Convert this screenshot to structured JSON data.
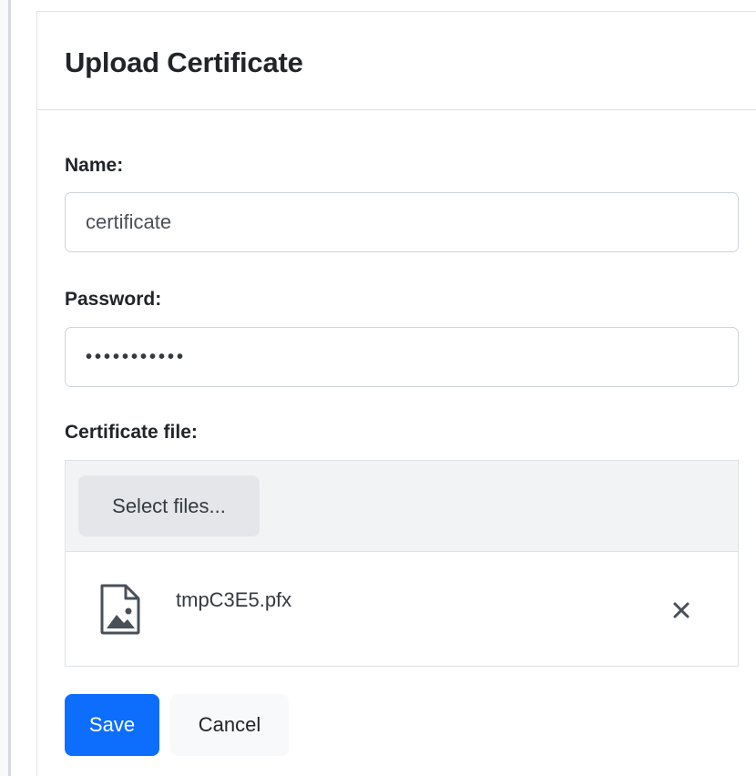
{
  "dialog": {
    "title": "Upload Certificate"
  },
  "form": {
    "name_label": "Name:",
    "name_value": "certificate",
    "password_label": "Password:",
    "password_value": "•••••••••••",
    "file_label": "Certificate file:"
  },
  "upload": {
    "select_button": "Select files...",
    "files": [
      {
        "name": "tmpC3E5.pfx",
        "icon": "file-image-icon"
      }
    ],
    "remove_icon": "close-icon"
  },
  "actions": {
    "save_label": "Save",
    "cancel_label": "Cancel"
  },
  "colors": {
    "primary": "#0d6efd",
    "border": "#dee2e6",
    "toolbar_bg": "#f1f3f5"
  }
}
